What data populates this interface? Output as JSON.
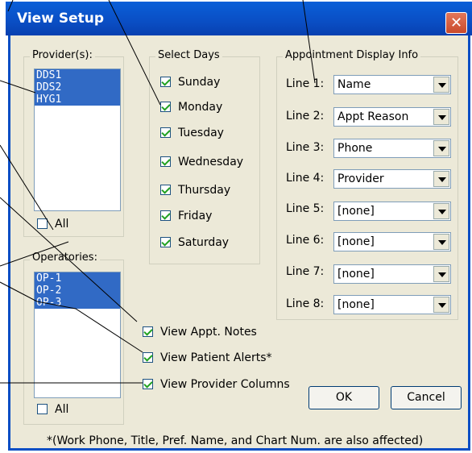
{
  "window": {
    "title": "View Setup",
    "close_glyph": "✕"
  },
  "providers": {
    "label": "Provider(s):",
    "items": [
      "DDS1",
      "DDS2",
      "HYG1"
    ],
    "all_label": "All",
    "all_checked": false
  },
  "operatories": {
    "label": "Operatories:",
    "items": [
      "OP-1",
      "OP-2",
      "OP-3"
    ],
    "all_label": "All",
    "all_checked": false
  },
  "days": {
    "label": "Select Days",
    "items": [
      {
        "label": "Sunday",
        "checked": true
      },
      {
        "label": "Monday",
        "checked": true
      },
      {
        "label": "Tuesday",
        "checked": true
      },
      {
        "label": "Wednesday",
        "checked": true
      },
      {
        "label": "Thursday",
        "checked": true
      },
      {
        "label": "Friday",
        "checked": true
      },
      {
        "label": "Saturday",
        "checked": true
      }
    ]
  },
  "appt": {
    "label": "Appointment Display Info",
    "lines": [
      {
        "label": "Line 1:",
        "value": "Name"
      },
      {
        "label": "Line 2:",
        "value": "Appt Reason"
      },
      {
        "label": "Line 3:",
        "value": "Phone"
      },
      {
        "label": "Line 4:",
        "value": "Provider"
      },
      {
        "label": "Line 5:",
        "value": "[none]"
      },
      {
        "label": "Line 6:",
        "value": "[none]"
      },
      {
        "label": "Line 7:",
        "value": "[none]"
      },
      {
        "label": "Line 8:",
        "value": "[none]"
      }
    ]
  },
  "options": {
    "notes": {
      "label": "View Appt. Notes",
      "checked": true
    },
    "alerts": {
      "label": "View Patient Alerts*",
      "checked": true
    },
    "provcols": {
      "label": "View Provider Columns",
      "checked": true
    }
  },
  "buttons": {
    "ok": "OK",
    "cancel": "Cancel"
  },
  "footnote": "*(Work Phone, Title, Pref. Name, and Chart Num. are also affected)",
  "colors": {
    "title_bar": "#0a4ec4",
    "selection": "#316ac5",
    "dialog_bg": "#ece9d8"
  }
}
